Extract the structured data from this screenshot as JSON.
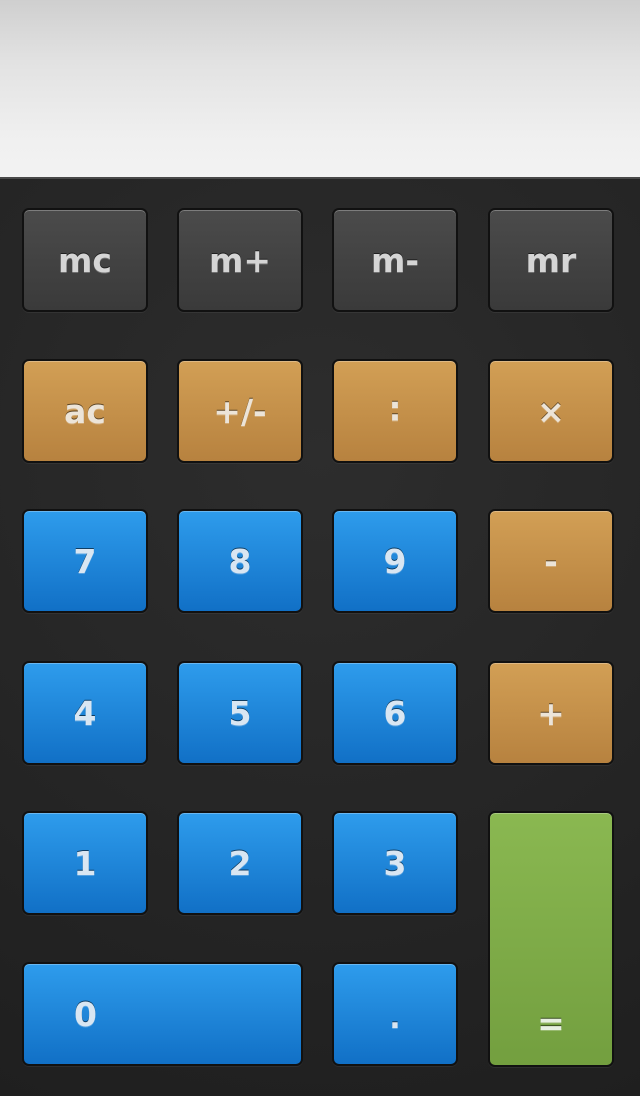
{
  "display": {
    "value": ""
  },
  "keys": {
    "mc": "mc",
    "mplus": "m+",
    "mminus": "m-",
    "mr": "mr",
    "ac": "ac",
    "plus_minus": "+/-",
    "divide": "∶",
    "multiply": "×",
    "seven": "7",
    "eight": "8",
    "nine": "9",
    "minus": "-",
    "four": "4",
    "five": "5",
    "six": "6",
    "plus": "+",
    "one": "1",
    "two": "2",
    "three": "3",
    "equals": "=",
    "zero": "0",
    "decimal": "."
  },
  "colors": {
    "memory": "#434343",
    "operator": "#c58f4a",
    "digit": "#1f86d9",
    "equals": "#80ac48",
    "background": "#222222",
    "display": "#e6e6e6"
  }
}
